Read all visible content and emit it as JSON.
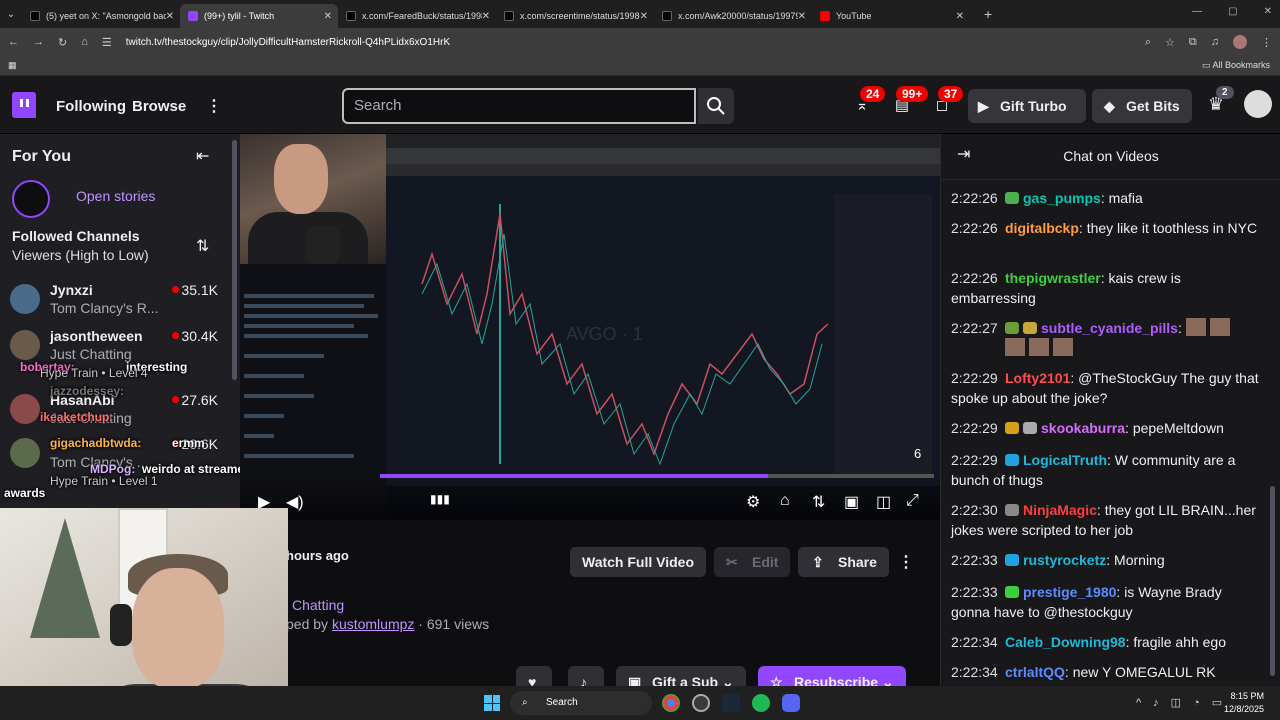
{
  "browser": {
    "tabs": [
      {
        "label": "(5) yeet on X: \"Asmongold bac...",
        "color": "#111111"
      },
      {
        "label": "(99+) tylil - Twitch",
        "color": "#9147ff"
      },
      {
        "label": "x.com/FearedBuck/status/1998...",
        "color": "#111111"
      },
      {
        "label": "x.com/screentime/status/19980...",
        "color": "#111111"
      },
      {
        "label": "x.com/Awk20000/status/19979...",
        "color": "#111111"
      },
      {
        "label": "YouTube",
        "color": "#ff0000"
      }
    ],
    "url": "twitch.tv/thestockguy/clip/JollyDifficultHamsterRickroll-Q4hPLidx6xO1HrK",
    "all_bookmarks": "All Bookmarks"
  },
  "twitch_header": {
    "following": "Following",
    "browse": "Browse",
    "search_placeholder": "Search",
    "badge_inbox": "24",
    "badge_notifications": "99+",
    "badge_whispers": "37",
    "gift_turbo": "Gift Turbo",
    "get_bits": "Get Bits",
    "badge_prime": "2"
  },
  "sidebar": {
    "title": "For You",
    "open_stories": "Open stories",
    "followed_title": "Followed Channels",
    "followed_sort": "Viewers (High to Low)",
    "channels": [
      {
        "name": "Jynxzi",
        "game": "Tom Clancy's R...",
        "viewers": "35.1K",
        "avatar": "#4a6a8a"
      },
      {
        "name": "jasontheween",
        "game": "Just Chatting",
        "viewers": "30.4K",
        "avatar": "#6a5a4a"
      },
      {
        "name": "HasanAbi",
        "game": "Just Chatting",
        "viewers": "27.6K",
        "avatar": "#8a4a4a"
      },
      {
        "name": "",
        "game": "Tom Clancy's ...",
        "viewers": "26.6K",
        "avatar": "#5a6a4a"
      }
    ],
    "overlay_messages": [
      "interesting",
      "Hype Train • Level 4",
      "ermm",
      "weirdo at streamer",
      "awards",
      "Hype Train • Level 1"
    ],
    "overlay_users": [
      "bobertay:",
      "jazzodessey:",
      "ikeaketchup:",
      "gigachadbtwda:",
      "MDPog:"
    ]
  },
  "player": {
    "time_label": "6",
    "watermark": "AVGO · 1",
    "progress": 0.7
  },
  "clip_info": {
    "hours_ago": "hours ago",
    "category": "Chatting",
    "clipped_by_prefix": "ped by",
    "clipped_by_user": "kustomlumpz",
    "views": " · 691 views",
    "watch_full": "Watch Full Video",
    "edit": "Edit",
    "share": "Share",
    "gift_sub": "Gift a Sub",
    "resubscribe": "Resubscribe"
  },
  "chat": {
    "title": "Chat on Videos",
    "messages": [
      {
        "ts": "2:22:26",
        "user": "gas_pumps",
        "color": "#00c8af",
        "badge": "#4caf50",
        "text": "mafia"
      },
      {
        "ts": "2:22:26",
        "user": "digitalbckp",
        "color": "#ff9c3d",
        "badge": "",
        "text": "they like it toothless in NYC"
      },
      {
        "ts": "2:22:26",
        "user": "thepigwrastler",
        "color": "#3bd03b",
        "badge": "",
        "text": "kais crew is embarressing"
      },
      {
        "ts": "2:22:27",
        "user": "subtle_cyanide_pills",
        "color": "#b05cff",
        "badge": "#6b9c38",
        "text": ""
      },
      {
        "ts": "2:22:29",
        "user": "Lofty2101",
        "color": "#ff4c4c",
        "badge": "",
        "text": "@TheStockGuy The guy that spoke up about the joke?"
      },
      {
        "ts": "2:22:29",
        "user": "skookaburra",
        "color": "#d86bff",
        "badge": "#d4a017",
        "text": "pepeMeltdown"
      },
      {
        "ts": "2:22:29",
        "user": "LogicalTruth",
        "color": "#1fb8d8",
        "badge": "#1fa3e0",
        "text": "W community are a bunch of thugs"
      },
      {
        "ts": "2:22:30",
        "user": "NinjaMagic",
        "color": "#ff3d3d",
        "badge": "#888888",
        "text": "they got LIL BRAIN...her jokes were scripted to her job"
      },
      {
        "ts": "2:22:33",
        "user": "rustyrocketz",
        "color": "#1fb8d8",
        "badge": "#1fa3e0",
        "text": "Morning"
      },
      {
        "ts": "2:22:33",
        "user": "prestige_1980",
        "color": "#5c8cff",
        "badge": "#3bd03b",
        "text": "is Wayne Brady gonna have to @thestockguy"
      },
      {
        "ts": "2:22:34",
        "user": "Caleb_Downing98",
        "color": "#1fb8d8",
        "badge": "",
        "text": "fragile ahh ego"
      },
      {
        "ts": "2:22:34",
        "user": "ctrlaltQQ",
        "color": "#5c8cff",
        "badge": "",
        "text": "new Y OMEGALUL RK"
      }
    ]
  },
  "taskbar": {
    "search": "Search",
    "time": "8:15 PM",
    "date": "12/8/2025"
  }
}
